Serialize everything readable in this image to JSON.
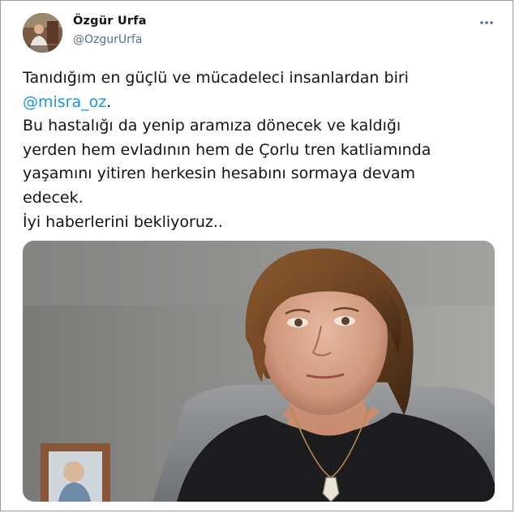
{
  "tweet": {
    "author": {
      "display_name": "Özgür Urfa",
      "handle": "@OzgurUrfa"
    },
    "more_icon": "more-horizontal-icon",
    "text_lines": {
      "line1": "Tanıdığım en güçlü ve mücadeleci insanlardan biri",
      "line2_mention": "@misra_oz",
      "line2_suffix": ".",
      "line3": "Bu hastalığı da yenip aramıza dönecek ve kaldığı",
      "line4": "yerden hem evladının hem de Çorlu tren katliamında",
      "line5": "yaşamını yitiren herkesin hesabını sormaya devam",
      "line6": "edecek.",
      "line7": "İyi haberlerini bekliyoruz.."
    }
  },
  "colors": {
    "mention": "#1b95e0",
    "handle": "#5b7083",
    "text": "#0f1419"
  }
}
